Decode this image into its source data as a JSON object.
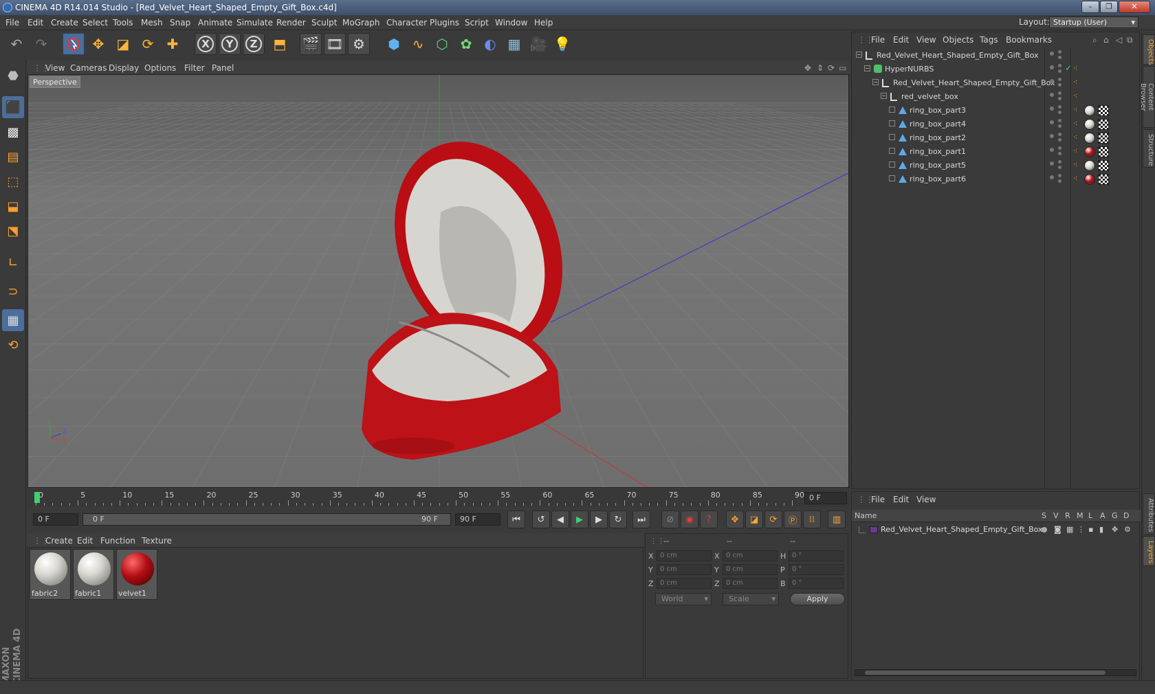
{
  "window": {
    "title": "CINEMA 4D R14.014 Studio - [Red_Velvet_Heart_Shaped_Empty_Gift_Box.c4d]",
    "controls": [
      "–",
      "❐",
      "✕"
    ]
  },
  "menu": [
    "File",
    "Edit",
    "Create",
    "Select",
    "Tools",
    "Mesh",
    "Snap",
    "Animate",
    "Simulate",
    "Render",
    "Sculpt",
    "MoGraph",
    "Character",
    "Plugins",
    "Script",
    "Window",
    "Help"
  ],
  "layout": {
    "label": "Layout:",
    "value": "Startup (User)"
  },
  "viewport": {
    "menu": [
      "View",
      "Cameras",
      "Display",
      "Options",
      "Filter",
      "Panel"
    ],
    "label": "Perspective",
    "axis": {
      "y": "Y",
      "z": "Z",
      "x": "X"
    }
  },
  "timeline": {
    "ticks": [
      "0",
      "5",
      "10",
      "15",
      "20",
      "25",
      "30",
      "35",
      "40",
      "45",
      "50",
      "55",
      "60",
      "65",
      "70",
      "75",
      "80",
      "85",
      "90"
    ],
    "current": "0 F",
    "start": "0 F",
    "range_start": "0 F",
    "range_end": "90 F",
    "end": "90 F"
  },
  "materials": {
    "menu": [
      "Create",
      "Edit",
      "Function",
      "Texture"
    ],
    "items": [
      {
        "name": "fabric2",
        "color": "#d8d6d0"
      },
      {
        "name": "fabric1",
        "color": "#d8d6d0"
      },
      {
        "name": "velvet1",
        "color": "#b30d12"
      }
    ]
  },
  "coords": {
    "header": [
      "--",
      "--",
      "--"
    ],
    "rows": [
      {
        "a": "X",
        "av": "0 cm",
        "b": "X",
        "bv": "0 cm",
        "c": "H",
        "cv": "0 °"
      },
      {
        "a": "Y",
        "av": "0 cm",
        "b": "Y",
        "bv": "0 cm",
        "c": "P",
        "cv": "0 °"
      },
      {
        "a": "Z",
        "av": "0 cm",
        "b": "Z",
        "bv": "0 cm",
        "c": "B",
        "cv": "0 °"
      }
    ],
    "world": "World",
    "scale": "Scale",
    "apply": "Apply"
  },
  "objects": {
    "menu": [
      "File",
      "Edit",
      "View",
      "Objects",
      "Tags",
      "Bookmarks"
    ],
    "tree": [
      {
        "name": "Red_Velvet_Heart_Shaped_Empty_Gift_Box",
        "depth": 0,
        "kind": "null"
      },
      {
        "name": "HyperNURBS",
        "depth": 1,
        "kind": "nurbs"
      },
      {
        "name": "Red_Velvet_Heart_Shaped_Empty_Gift_Box",
        "depth": 2,
        "kind": "null"
      },
      {
        "name": "red_velvet_box",
        "depth": 3,
        "kind": "null"
      },
      {
        "name": "ring_box_part3",
        "depth": 4,
        "kind": "poly",
        "mat": "#d8d6d0"
      },
      {
        "name": "ring_box_part4",
        "depth": 4,
        "kind": "poly",
        "mat": "#d8d6d0"
      },
      {
        "name": "ring_box_part2",
        "depth": 4,
        "kind": "poly",
        "mat": "#d8d6d0"
      },
      {
        "name": "ring_box_part1",
        "depth": 4,
        "kind": "poly",
        "mat": "#b30d12"
      },
      {
        "name": "ring_box_part5",
        "depth": 4,
        "kind": "poly",
        "mat": "#d8d6d0"
      },
      {
        "name": "ring_box_part6",
        "depth": 4,
        "kind": "poly",
        "mat": "#b30d12"
      }
    ]
  },
  "layers": {
    "menu": [
      "File",
      "Edit",
      "View"
    ],
    "columns": {
      "name": "Name",
      "flags": [
        "S",
        "V",
        "R",
        "M",
        "L",
        "A",
        "G",
        "D"
      ]
    },
    "rows": [
      {
        "name": "Red_Velvet_Heart_Shaped_Empty_Gift_Box",
        "color": "#6b3a8f"
      }
    ]
  },
  "right_tabs": [
    "Objects",
    "Content Browser",
    "Structure",
    "Attributes",
    "Layers"
  ],
  "branding": "MAXON CINEMA 4D",
  "colors": {
    "accent": "#ffa52e",
    "selection": "#4b6e9a",
    "velvet": "#b30d12"
  }
}
